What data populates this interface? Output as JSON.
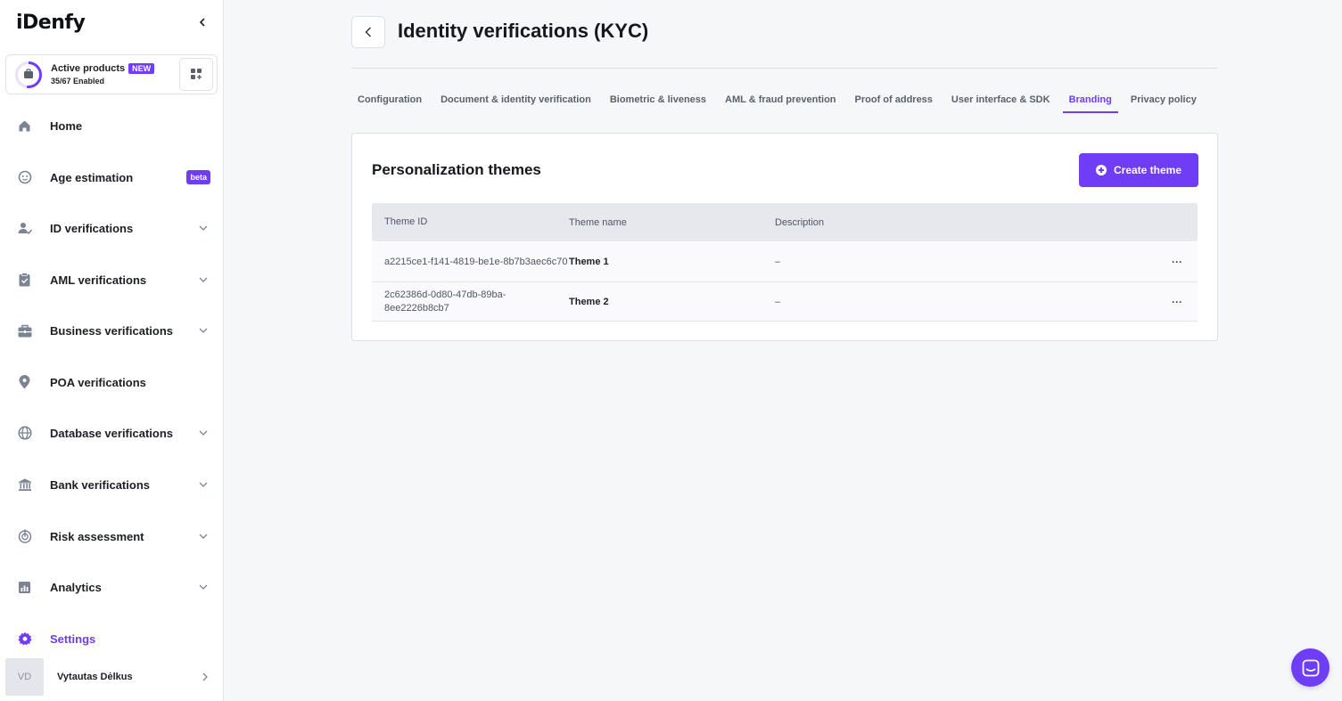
{
  "app": {
    "logo": "iDenfy"
  },
  "products": {
    "title": "Active products",
    "badge": "NEW",
    "enabled": "35/67 Enabled",
    "progress_fraction": 0.52
  },
  "sidebar": {
    "items": [
      {
        "label": "Home",
        "icon": "home-icon"
      },
      {
        "label": "Age estimation",
        "icon": "face-icon",
        "badge": "beta"
      },
      {
        "label": "ID verifications",
        "icon": "user-check-icon"
      },
      {
        "label": "AML verifications",
        "icon": "clipboard-check-icon"
      },
      {
        "label": "Business verifications",
        "icon": "briefcase-icon"
      },
      {
        "label": "POA verifications",
        "icon": "location-pin-icon"
      },
      {
        "label": "Database verifications",
        "icon": "globe-icon"
      },
      {
        "label": "Bank verifications",
        "icon": "bank-icon"
      },
      {
        "label": "Risk assessment",
        "icon": "risk-gauge-icon"
      },
      {
        "label": "Analytics",
        "icon": "bar-chart-icon"
      },
      {
        "label": "Settings",
        "icon": "gear-icon"
      }
    ]
  },
  "user": {
    "initials": "VD",
    "name": "Vytautas Dėlkus"
  },
  "page": {
    "title": "Identity verifications (KYC)"
  },
  "tabs": [
    {
      "label": "Configuration"
    },
    {
      "label": "Document & identity verification"
    },
    {
      "label": "Biometric & liveness"
    },
    {
      "label": "AML & fraud prevention"
    },
    {
      "label": "Proof of address"
    },
    {
      "label": "User interface & SDK"
    },
    {
      "label": "Branding"
    },
    {
      "label": "Privacy policy"
    }
  ],
  "themes": {
    "title": "Personalization themes",
    "create_label": "Create theme",
    "columns": [
      "Theme ID",
      "Theme name",
      "Description"
    ],
    "rows": [
      {
        "id": "a2215ce1-f141-4819-be1e-8b7b3aec6c70",
        "name": "Theme 1",
        "description": "–",
        "menu": "···"
      },
      {
        "id": "2c62386d-0d80-47db-89ba-8ee2226b8cb7",
        "name": "Theme 2",
        "description": "–",
        "menu": "···"
      }
    ]
  },
  "colors": {
    "accent": "#6e3df5",
    "icon_gray": "#7b8394"
  }
}
